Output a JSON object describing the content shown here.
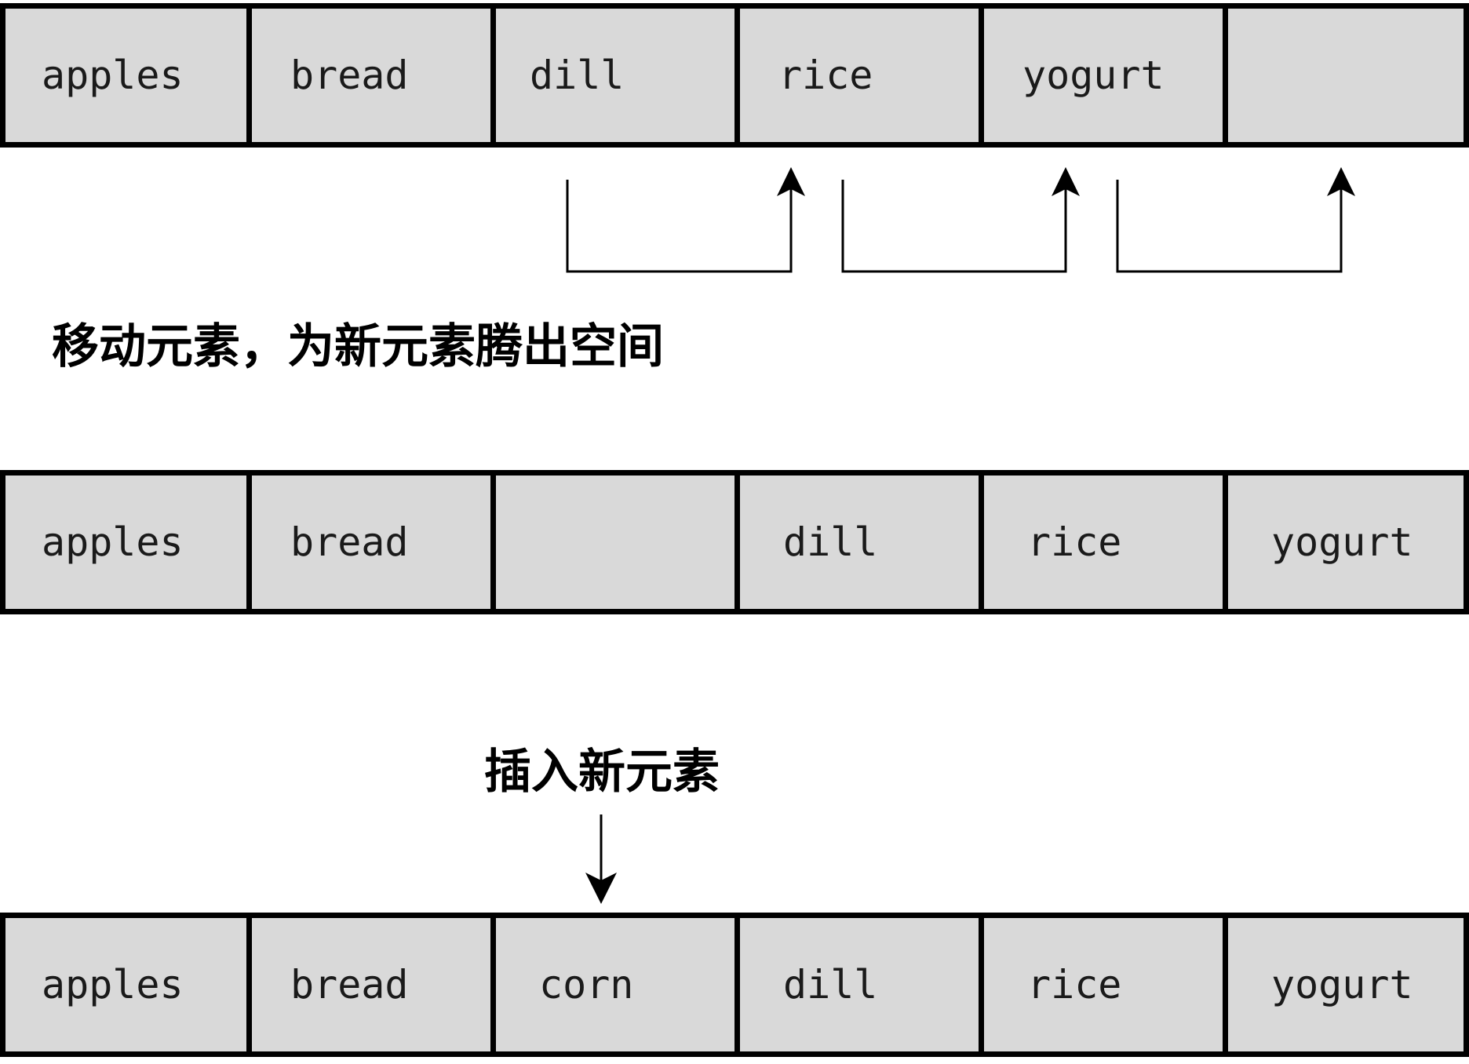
{
  "rows": [
    {
      "name": "before-shift",
      "cells": [
        "apples",
        "bread",
        "dill",
        "rice",
        "yogurt",
        ""
      ]
    },
    {
      "name": "after-shift",
      "cells": [
        "apples",
        "bread",
        "",
        "dill",
        "rice",
        "yogurt"
      ]
    },
    {
      "name": "after-insert",
      "cells": [
        "apples",
        "bread",
        "corn",
        "dill",
        "rice",
        "yogurt"
      ]
    }
  ],
  "captions": {
    "shift": "移动元素，为新元素腾出空间",
    "insert": "插入新元素"
  },
  "colors": {
    "cell_fill": "#d9d9d9",
    "border": "#000000",
    "text": "#1a1a1a",
    "background": "#ffffff"
  }
}
